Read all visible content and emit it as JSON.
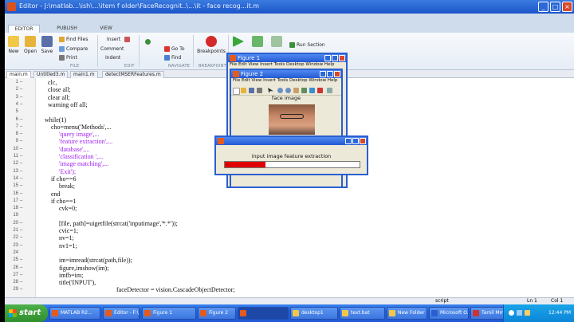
{
  "window": {
    "title": "Editor - J:\\matlab...\\ish\\...\\item f older\\FaceRecognit..\\...\\it - face recog...it.m"
  },
  "ribbon_tabs": [
    {
      "label": "EDITOR"
    },
    {
      "label": "PUBLISH"
    },
    {
      "label": "VIEW"
    }
  ],
  "ribbon": {
    "new": "New",
    "open": "Open",
    "save": "Save",
    "find_files": "Find Files",
    "compare": "Compare",
    "print": "Print",
    "insert": "Insert",
    "comment": "Comment",
    "indent": "Indent",
    "go_to": "Go To",
    "find": "Find",
    "breakpoints": "Breakpoints",
    "run_section": "Run Section",
    "group_file": "FILE",
    "group_edit": "EDIT",
    "group_navigate": "NAVIGATE",
    "group_breakpoints": "BREAKPOINTS"
  },
  "file_tabs": [
    {
      "label": "main.m"
    },
    {
      "label": "Untitled3.m"
    },
    {
      "label": "main1.m"
    },
    {
      "label": "detectMSERFeatures.m"
    }
  ],
  "code_lines": [
    {
      "n": "1",
      "text": "clc,"
    },
    {
      "n": "2",
      "text": "close all;"
    },
    {
      "n": "3",
      "text": "clear all;"
    },
    {
      "n": "4",
      "text": "warning off all;"
    },
    {
      "n": "5",
      "text": ""
    },
    {
      "n": "6",
      "text": "while(1)"
    },
    {
      "n": "7",
      "text": "cho=menu('Methods',..."
    },
    {
      "n": "8",
      "text": "'query image',..."
    },
    {
      "n": "9",
      "text": "'feature extraction',..."
    },
    {
      "n": "10",
      "text": "'database',..."
    },
    {
      "n": "11",
      "text": "'classification ',..."
    },
    {
      "n": "12",
      "text": "'image matching',..."
    },
    {
      "n": "13",
      "text": "'Exit');"
    },
    {
      "n": "14",
      "text": "if cho==6"
    },
    {
      "n": "15",
      "text": "break;"
    },
    {
      "n": "16",
      "text": "end"
    },
    {
      "n": "17",
      "text": "if cho==1"
    },
    {
      "n": "18",
      "text": "cvk=0;"
    },
    {
      "n": "19",
      "text": ""
    },
    {
      "n": "20",
      "text": "[file, path]=uigetfile(strcat('inputimage','*.*'));"
    },
    {
      "n": "21",
      "text": "cvic=1;"
    },
    {
      "n": "22",
      "text": "nv=1;"
    },
    {
      "n": "23",
      "text": "nv1=1;"
    },
    {
      "n": "24",
      "text": ""
    },
    {
      "n": "25",
      "text": "im=imread(strcat(path,file));"
    },
    {
      "n": "26",
      "text": "figure,imshow(im);"
    },
    {
      "n": "27",
      "text": "imfb=im;"
    },
    {
      "n": "28",
      "text": "title('INPUT'),"
    },
    {
      "n": "29",
      "text": "faceDetector = vision.CascadeObjectDetector;"
    }
  ],
  "figure1": {
    "title": "Figure 1",
    "menu": "File  Edit  View  Insert  Tools  Desktop  Window  Help"
  },
  "figure2": {
    "title": "Figure 2",
    "menu": "File  Edit  View  Insert  Tools  Desktop  Window  Help",
    "axes_title": "face image"
  },
  "progress": {
    "message": "input image feature extraction",
    "fraction": 0.3
  },
  "status": {
    "mode": "script",
    "ln": "Ln 1",
    "col": "Col 1"
  },
  "taskbar": {
    "start": "start",
    "items": [
      {
        "label": "MATLAB R2..."
      },
      {
        "label": "Editor - F:\\..."
      },
      {
        "label": "Figure 1"
      },
      {
        "label": "Figure 2"
      },
      {
        "label": ""
      },
      {
        "label": "desktop1"
      },
      {
        "label": "text.bat"
      },
      {
        "label": "New Folder"
      },
      {
        "label": "Microsoft O..."
      },
      {
        "label": "Tamil Mmm..."
      }
    ],
    "clock": "12:44 PM"
  }
}
